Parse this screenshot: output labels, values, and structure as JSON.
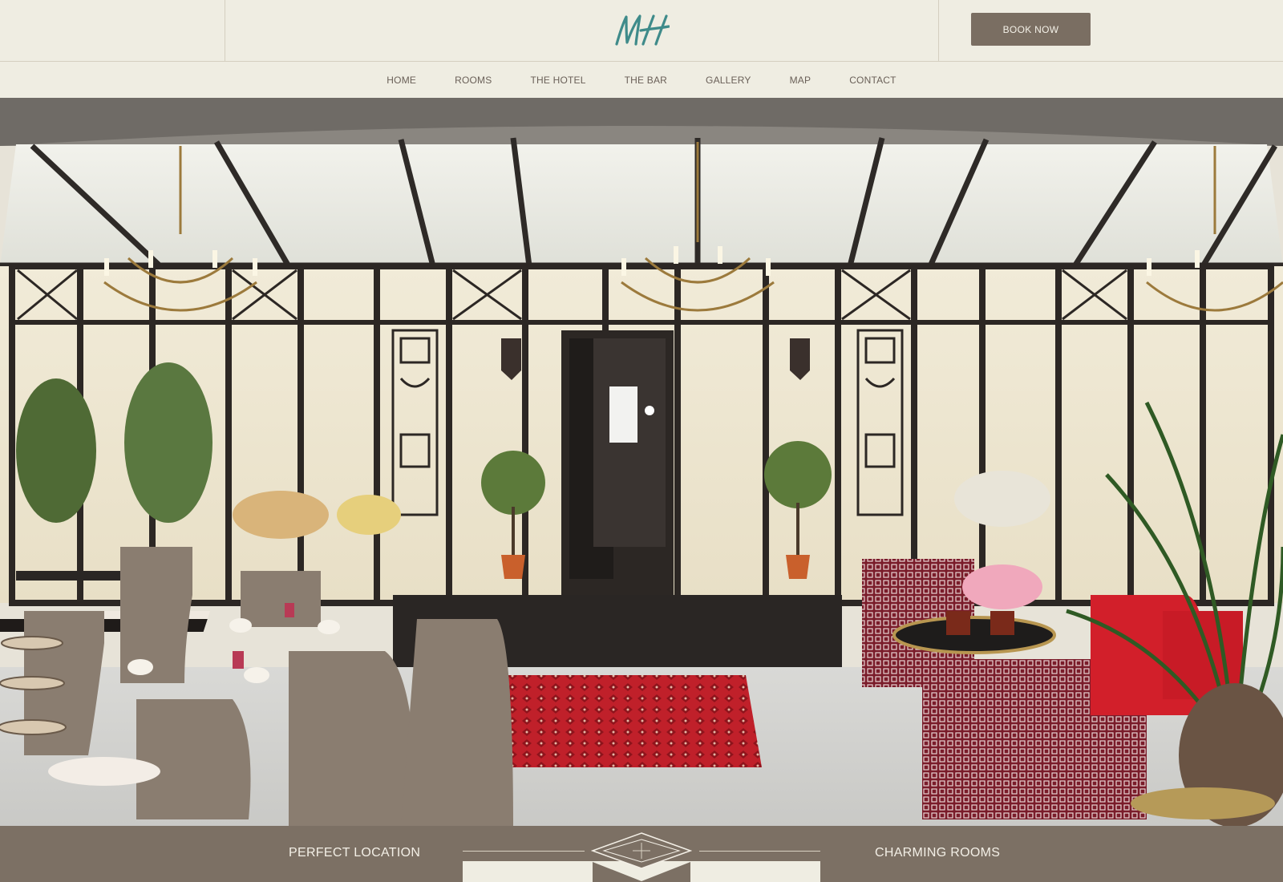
{
  "header": {
    "logo_text": "MH",
    "book_label": "BOOK NOW"
  },
  "nav": {
    "items": [
      "HOME",
      "ROOMS",
      "THE HOTEL",
      "THE BAR",
      "GALLERY",
      "MAP",
      "CONTACT"
    ]
  },
  "hero": {
    "image_description_icon": "hotel-conservatory-photo"
  },
  "features": {
    "left": "PERFECT LOCATION",
    "right": "CHARMING ROOMS"
  },
  "colors": {
    "background": "#efede2",
    "button": "#7a6e62",
    "band": "#7c7064",
    "logo": "#3f8b8a"
  }
}
